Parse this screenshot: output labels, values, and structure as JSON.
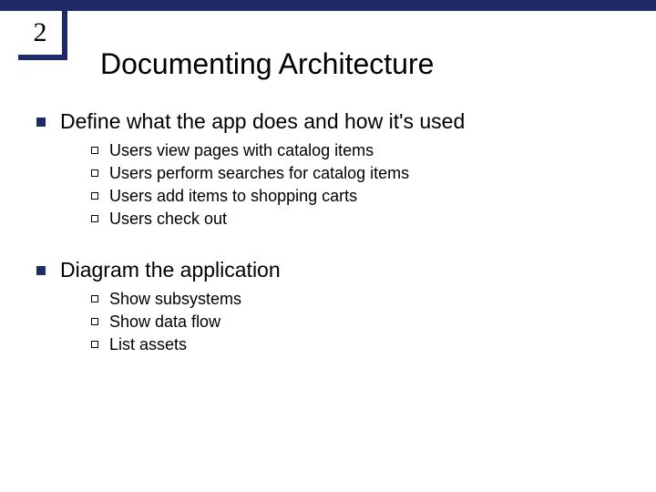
{
  "page_number": "2",
  "title": "Documenting Architecture",
  "sections": [
    {
      "heading": "Define what the app does and how it's used",
      "items": [
        "Users view pages with catalog items",
        "Users perform searches for catalog items",
        "Users add items to shopping carts",
        "Users check out"
      ]
    },
    {
      "heading": "Diagram the application",
      "items": [
        "Show subsystems",
        "Show data flow",
        "List assets"
      ]
    }
  ]
}
